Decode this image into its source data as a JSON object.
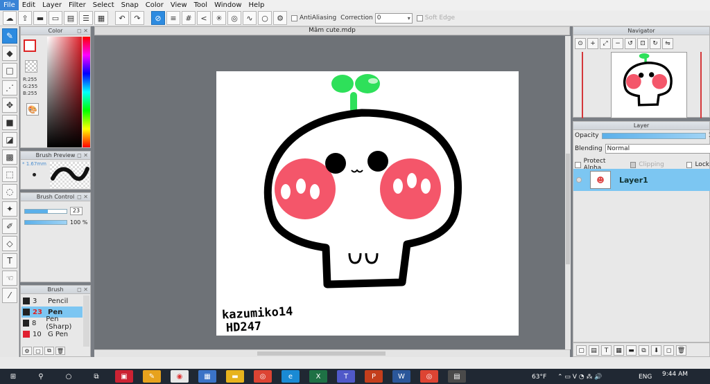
{
  "menu": [
    "File",
    "Edit",
    "Layer",
    "Filter",
    "Select",
    "Snap",
    "Color",
    "View",
    "Tool",
    "Window",
    "Help"
  ],
  "toolbar": {
    "antialiasing_label": "AntiAliasing",
    "correction_label": "Correction",
    "correction_value": "0",
    "soft_edge_label": "Soft Edge"
  },
  "color_panel": {
    "title": "Color",
    "r": "R:255",
    "g": "G:255",
    "b": "B:255"
  },
  "brush_preview": {
    "title": "Brush Preview",
    "size": "* 1.67mm"
  },
  "brush_control": {
    "title": "Brush Control",
    "size_value": "23",
    "opacity_value": "100 %"
  },
  "brush_list": {
    "title": "Brush",
    "items": [
      {
        "num": "3",
        "name": "Pencil",
        "color": "#222222"
      },
      {
        "num": "23",
        "name": "Pen",
        "color": "#222222",
        "selected": true
      },
      {
        "num": "8",
        "name": "Pen (Sharp)",
        "color": "#222222"
      },
      {
        "num": "10",
        "name": "G Pen",
        "color": "#e02030"
      }
    ]
  },
  "document": {
    "tab_title": "Mâm cute.mdp"
  },
  "artwork": {
    "signature_line1": "kazumiko14",
    "signature_line2": "HD247"
  },
  "navigator": {
    "title": "Navigator"
  },
  "layer_panel": {
    "title": "Layer",
    "opacity_label": "Opacity",
    "opacity_value": "10",
    "blending_label": "Blending",
    "blending_value": "Normal",
    "protect_alpha": "Protect Alpha",
    "clipping": "Clipping",
    "lock": "Lock",
    "layer_name": "Layer1"
  },
  "taskbar": {
    "weather": "63°F",
    "lang": "ENG",
    "time": "9:44 AM"
  },
  "colors": {
    "accent": "#2d8be0",
    "selection": "#7cc6f2",
    "taskbar": "#202833"
  }
}
